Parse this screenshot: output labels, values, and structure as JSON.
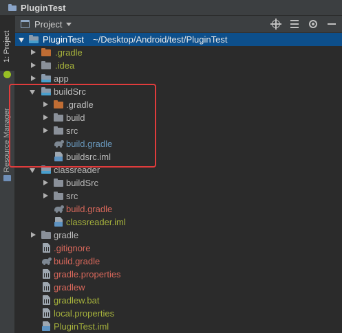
{
  "window": {
    "title": "PluginTest"
  },
  "tool_strip": {
    "project_tab": "1: Project",
    "resource_manager_tab": "Resource Manager"
  },
  "panel": {
    "view_selector": "Project",
    "icons": [
      "locate-crosshair-icon",
      "collapse-all-icon",
      "settings-gear-icon",
      "hide-icon"
    ]
  },
  "tree": [
    {
      "label": "PluginTest",
      "path": "~/Desktop/Android/test/PluginTest",
      "icon": "module-folder-icon",
      "expanded": true,
      "selected": true,
      "color": "#ffffff"
    },
    {
      "label": ".gradle",
      "icon": "folder-orange-icon",
      "expanded": false,
      "color": "#a6b23c"
    },
    {
      "label": ".idea",
      "icon": "folder-gray-icon",
      "expanded": false,
      "color": "#a6b23c"
    },
    {
      "label": "app",
      "icon": "module-folder-icon",
      "expanded": false,
      "color": "#bbbbbb"
    },
    {
      "label": "buildSrc",
      "icon": "module-folder-icon",
      "expanded": true,
      "color": "#bbbbbb"
    },
    {
      "label": ".gradle",
      "icon": "folder-orange-icon",
      "expanded": false,
      "color": "#bbbbbb"
    },
    {
      "label": "build",
      "icon": "folder-gray-icon",
      "expanded": false,
      "color": "#bbbbbb"
    },
    {
      "label": "src",
      "icon": "folder-gray-icon",
      "expanded": false,
      "color": "#bbbbbb"
    },
    {
      "label": "build.gradle",
      "icon": "gradle-icon",
      "color": "#6897bb"
    },
    {
      "label": "buildsrc.iml",
      "icon": "iml-file-icon",
      "color": "#bbbbbb"
    },
    {
      "label": "classreader",
      "icon": "module-folder-icon",
      "expanded": true,
      "color": "#bbbbbb"
    },
    {
      "label": "buildSrc",
      "icon": "folder-gray-icon",
      "expanded": false,
      "color": "#bbbbbb"
    },
    {
      "label": "src",
      "icon": "folder-gray-icon",
      "expanded": false,
      "color": "#bbbbbb"
    },
    {
      "label": "build.gradle",
      "icon": "gradle-icon",
      "color": "#d9685b"
    },
    {
      "label": "classreader.iml",
      "icon": "iml-file-icon",
      "color": "#a6b23c"
    },
    {
      "label": "gradle",
      "icon": "folder-gray-icon",
      "expanded": false,
      "color": "#bbbbbb"
    },
    {
      "label": ".gitignore",
      "icon": "text-file-icon",
      "color": "#d9685b"
    },
    {
      "label": "build.gradle",
      "icon": "gradle-icon",
      "color": "#d9685b"
    },
    {
      "label": "gradle.properties",
      "icon": "properties-file-icon",
      "color": "#d9685b"
    },
    {
      "label": "gradlew",
      "icon": "text-file-icon",
      "color": "#d9685b"
    },
    {
      "label": "gradlew.bat",
      "icon": "text-file-icon",
      "color": "#a6b23c"
    },
    {
      "label": "local.properties",
      "icon": "properties-file-icon",
      "color": "#a6b23c"
    },
    {
      "label": "PluginTest.iml",
      "icon": "iml-file-icon",
      "color": "#a6b23c"
    }
  ],
  "colors": {
    "background": "#2b2b2b",
    "selection": "#0d4f8b",
    "highlight_box": "#e03c3c",
    "folder_gray": "#8a9099",
    "folder_orange": "#c06d34",
    "module_folder": "#8a9aab"
  }
}
